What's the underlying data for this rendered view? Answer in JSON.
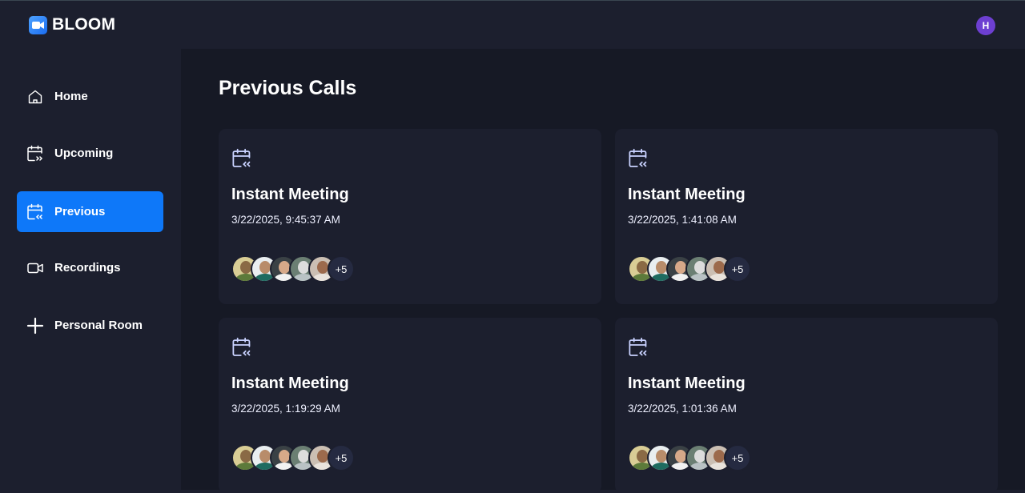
{
  "app": {
    "name": "BLOOM",
    "user_initial": "H"
  },
  "sidebar": {
    "items": [
      {
        "label": "Home",
        "icon": "home-icon",
        "active": false
      },
      {
        "label": "Upcoming",
        "icon": "calendar-forward-icon",
        "active": false
      },
      {
        "label": "Previous",
        "icon": "calendar-back-icon",
        "active": true
      },
      {
        "label": "Recordings",
        "icon": "video-icon",
        "active": false
      },
      {
        "label": "Personal Room",
        "icon": "plus-icon",
        "active": false
      }
    ]
  },
  "main": {
    "title": "Previous Calls",
    "cards": [
      {
        "title": "Instant Meeting",
        "date": "3/22/2025, 9:45:37 AM",
        "more_count": "+5"
      },
      {
        "title": "Instant Meeting",
        "date": "3/22/2025, 1:41:08 AM",
        "more_count": "+5"
      },
      {
        "title": "Instant Meeting",
        "date": "3/22/2025, 1:19:29 AM",
        "more_count": "+5"
      },
      {
        "title": "Instant Meeting",
        "date": "3/22/2025, 1:01:36 AM",
        "more_count": "+5"
      }
    ]
  },
  "colors": {
    "accent": "#0e78f9",
    "background": "#161925",
    "panel": "#1c1f2e",
    "avatar": "#6d3fd1"
  }
}
